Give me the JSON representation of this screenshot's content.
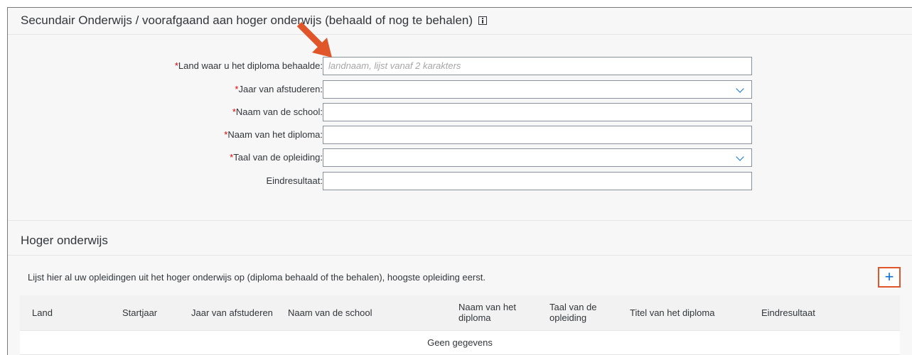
{
  "secondary": {
    "title": "Secundair Onderwijs / voorafgaand aan hoger onderwijs (behaald of nog te behalen)",
    "fields": [
      {
        "required_mark": "*",
        "label": "Land waar u het diploma behaalde:",
        "value": "",
        "placeholder": "landnaam, lijst vanaf 2 karakters",
        "type": "text"
      },
      {
        "required_mark": "*",
        "label": "Jaar van afstuderen:",
        "value": "",
        "placeholder": "",
        "type": "select"
      },
      {
        "required_mark": "*",
        "label": "Naam van de school:",
        "value": "",
        "placeholder": "",
        "type": "text"
      },
      {
        "required_mark": "*",
        "label": "Naam van het diploma:",
        "value": "",
        "placeholder": "",
        "type": "text"
      },
      {
        "required_mark": "*",
        "label": "Taal van de opleiding:",
        "value": "",
        "placeholder": "",
        "type": "select"
      },
      {
        "required_mark": "",
        "label": "Eindresultaat:",
        "value": "",
        "placeholder": "",
        "type": "text"
      }
    ]
  },
  "higher": {
    "title": "Hoger onderwijs",
    "description": "Lijst hier al uw opleidingen uit het hoger onderwijs op (diploma behaald of the behalen), hoogste opleiding eerst.",
    "add_label": "+",
    "columns": [
      "Land",
      "Startjaar",
      "Jaar van afstuderen",
      "Naam van de school",
      "Naam van het diploma",
      "Taal van de opleiding",
      "Titel van het diploma",
      "Eindresultaat"
    ],
    "empty_text": "Geen gegevens"
  },
  "colors": {
    "accent": "#0a6ed1",
    "required": "#e00000",
    "annotation": "#e0552a"
  },
  "icons": {
    "info": "info-icon",
    "dropdown": "chevron-down-icon",
    "annotation": "arrow-icon",
    "add": "plus-icon"
  }
}
